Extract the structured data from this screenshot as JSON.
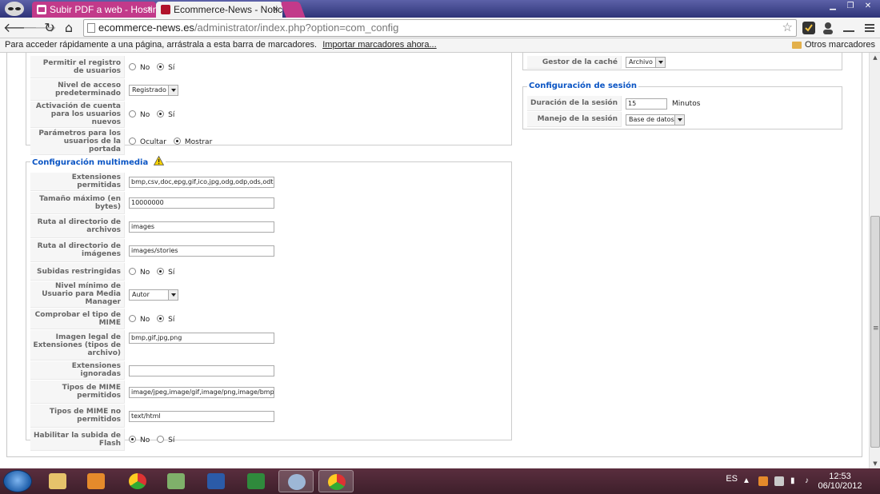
{
  "browser": {
    "tabs": [
      {
        "title": "Subir PDF a web - Hosting"
      },
      {
        "title": "Ecommerce-News - Notici"
      }
    ],
    "url_host": "ecommerce-news.es",
    "url_path": "/administrator/index.php?option=com_config",
    "bookmarks_prompt": "Para acceder rápidamente a una página, arrástrala a esta barra de marcadores.",
    "bookmarks_import": "Importar marcadores ahora...",
    "other_bookmarks": "Otros marcadores"
  },
  "users_section": {
    "rows": [
      {
        "label": "Permitir el registro de usuarios",
        "type": "radio",
        "options": [
          "No",
          "Sí"
        ],
        "selected": "Sí"
      },
      {
        "label": "Nivel de acceso predeterminado",
        "type": "select",
        "value": "Registrado"
      },
      {
        "label": "Activación de cuenta para los usuarios nuevos",
        "type": "radio",
        "options": [
          "No",
          "Sí"
        ],
        "selected": "Sí"
      },
      {
        "label": "Parámetros para los usuarios de la portada",
        "type": "radio",
        "options": [
          "Ocultar",
          "Mostrar"
        ],
        "selected": "Mostrar"
      }
    ]
  },
  "media_section": {
    "title": "Configuración multimedia",
    "rows": [
      {
        "label": "Extensiones permitidas",
        "type": "text",
        "value": "bmp,csv,doc,epg,gif,ico,jpg,odg,odp,ods,odt,pd"
      },
      {
        "label": "Tamaño máximo (en bytes)",
        "type": "text",
        "value": "10000000"
      },
      {
        "label": "Ruta al directorio de archivos",
        "type": "text",
        "value": "images"
      },
      {
        "label": "Ruta al directorio de imágenes",
        "type": "text",
        "value": "images/stories"
      },
      {
        "label": "Subidas restringidas",
        "type": "radio",
        "options": [
          "No",
          "Sí"
        ],
        "selected": "Sí"
      },
      {
        "label": "Nivel mínimo de Usuario para Media Manager",
        "type": "select",
        "value": "Autor"
      },
      {
        "label": "Comprobar el tipo de MIME",
        "type": "radio",
        "options": [
          "No",
          "Sí"
        ],
        "selected": "Sí"
      },
      {
        "label": "Imagen legal de Extensiones (tipos de archivo)",
        "type": "text",
        "value": "bmp,gif,jpg,png"
      },
      {
        "label": "Extensiones ignoradas",
        "type": "text",
        "value": ""
      },
      {
        "label": "Tipos de MIME permitidos",
        "type": "text",
        "value": "image/jpeg,image/gif,image/png,image/bmp,a"
      },
      {
        "label": "Tipos de MIME no permitidos",
        "type": "text",
        "value": "text/html"
      },
      {
        "label": "Habilitar la subida de Flash",
        "type": "radio",
        "options": [
          "No",
          "Sí"
        ],
        "selected": "No"
      }
    ]
  },
  "cache_section": {
    "rows": [
      {
        "label": "Gestor de la caché",
        "type": "select",
        "value": "Archivo"
      }
    ]
  },
  "session_section": {
    "title": "Configuración de sesión",
    "rows": [
      {
        "label": "Duración de la sesión",
        "type": "text",
        "value": "15",
        "unit": "Minutos"
      },
      {
        "label": "Manejo de la sesión",
        "type": "select",
        "value": "Base de datos"
      }
    ]
  },
  "taskbar": {
    "language": "ES",
    "time": "12:53",
    "date": "06/10/2012"
  },
  "colors": {
    "legend": "#0b55c4",
    "tab_active": "#c23a8a",
    "taskbar": "#4a2634"
  }
}
